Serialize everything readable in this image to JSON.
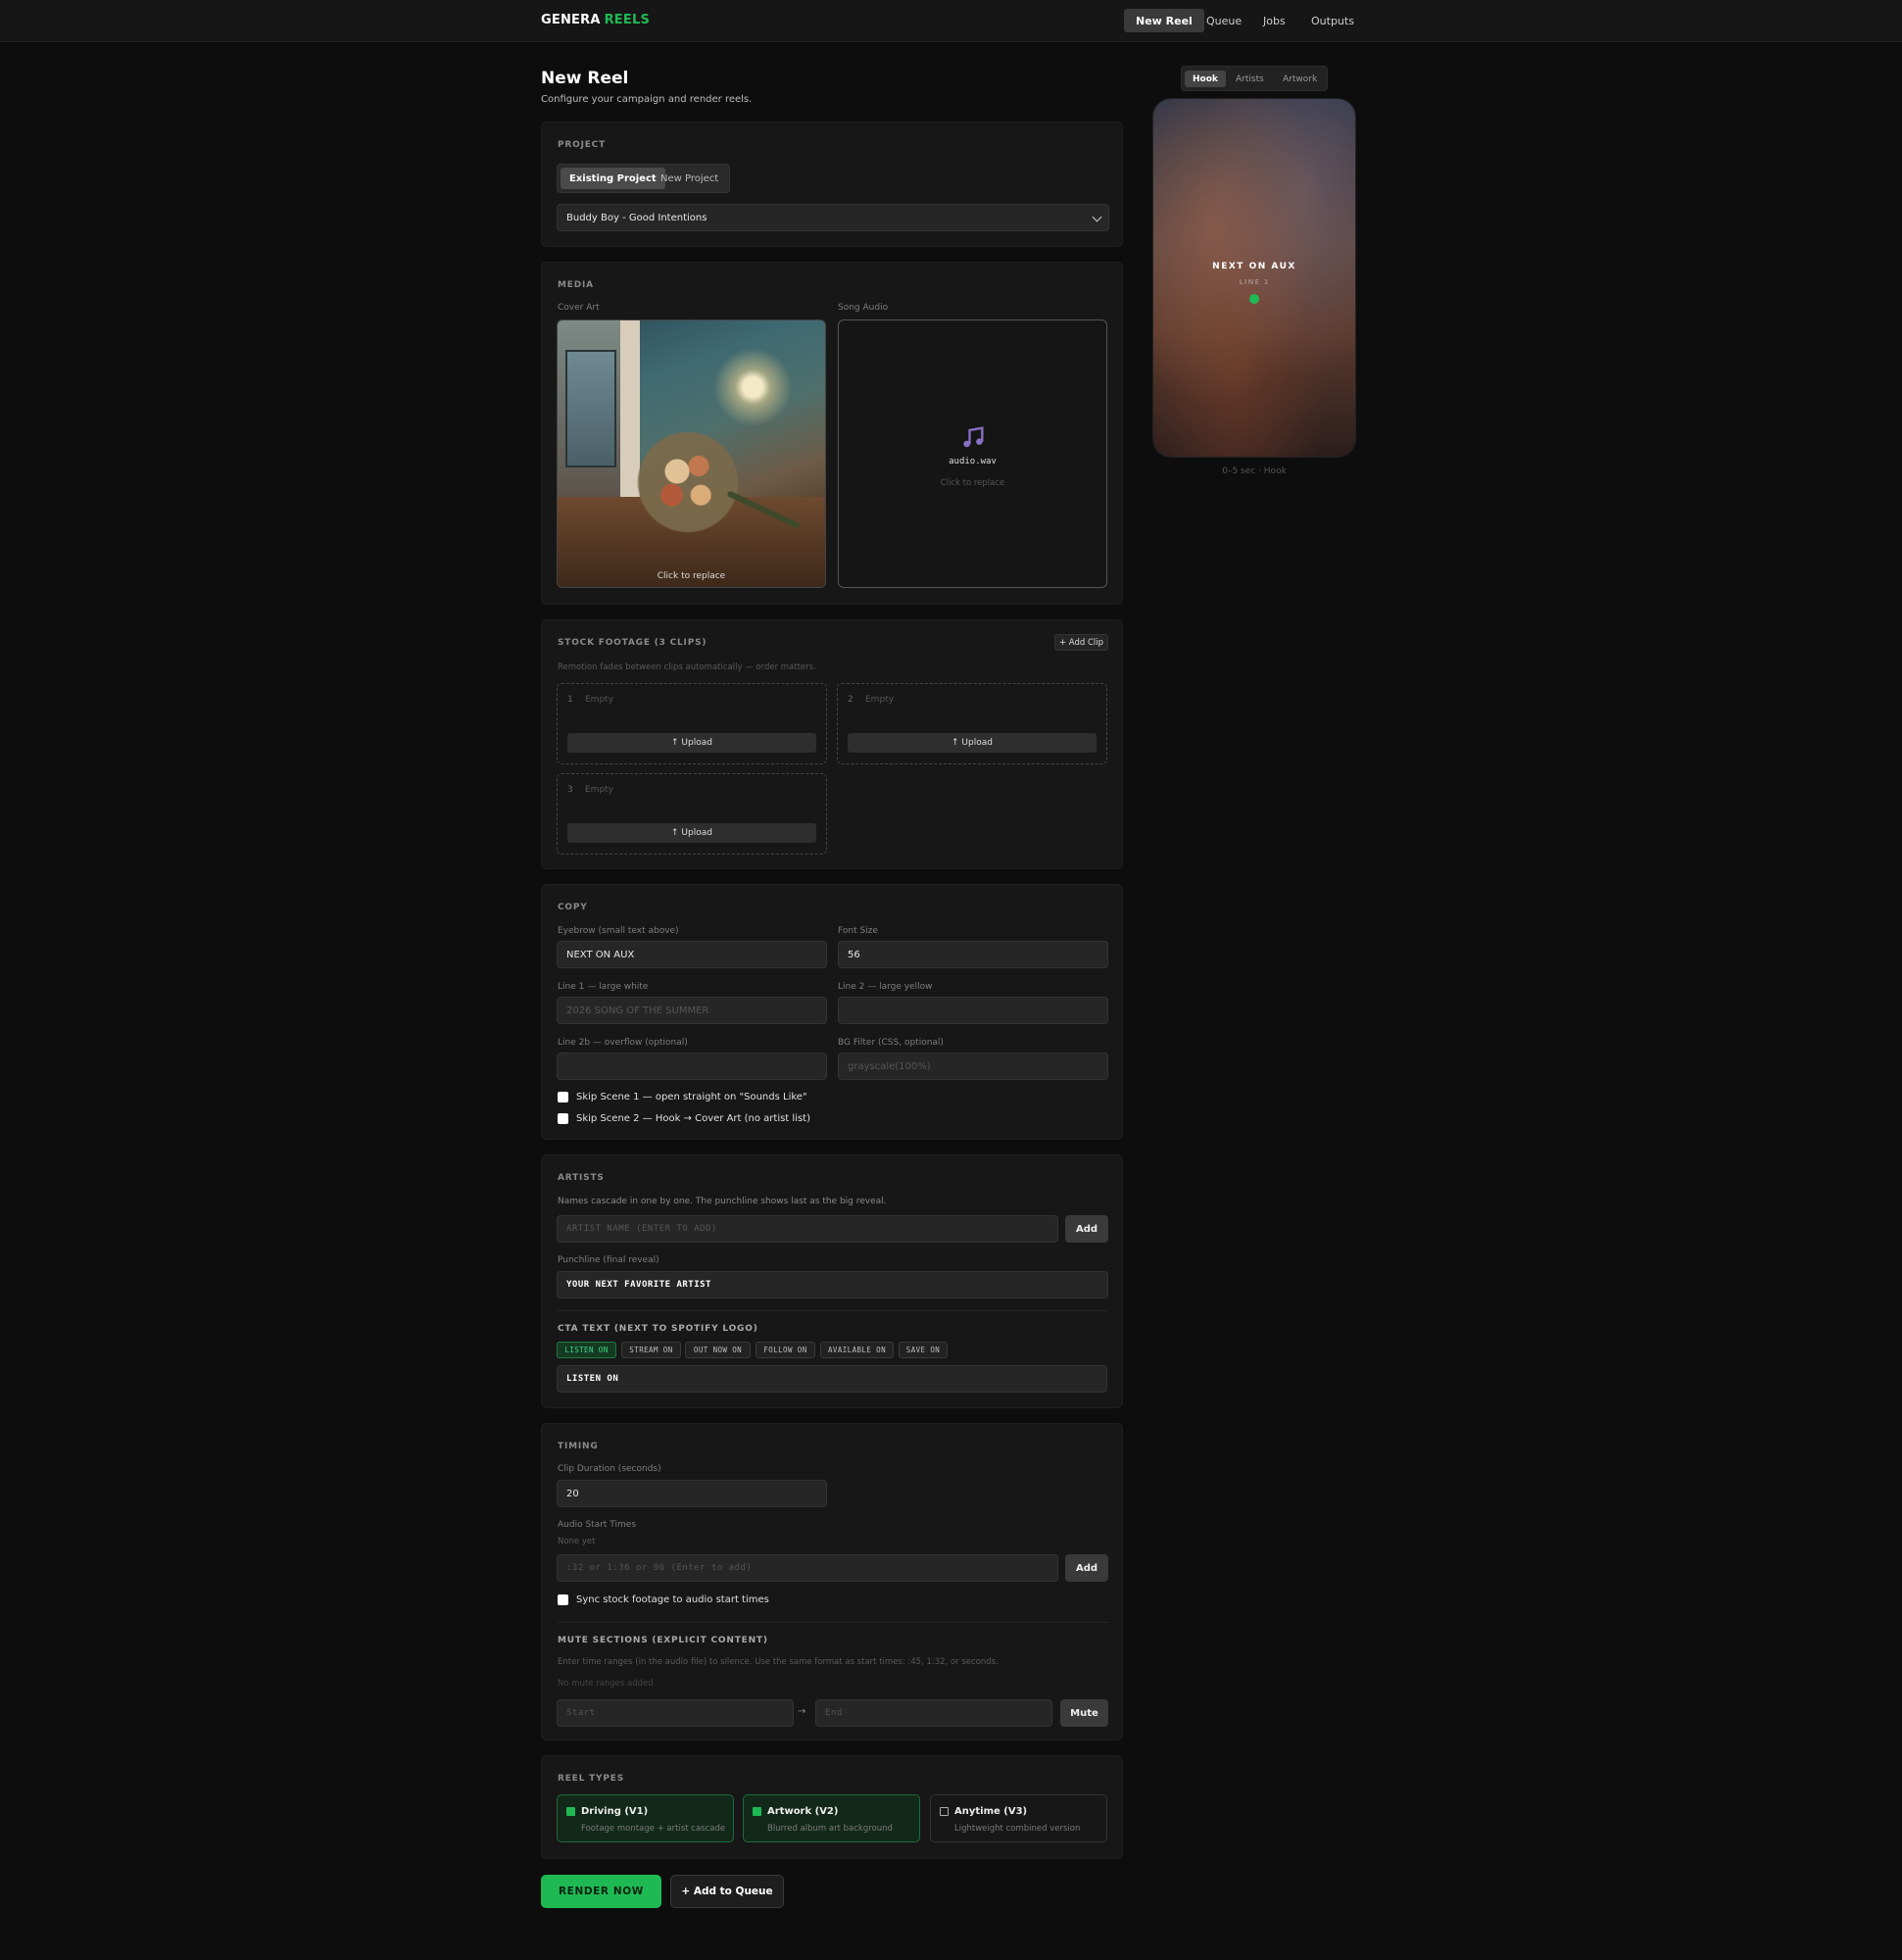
{
  "app": {
    "brand_part1": "GENERA",
    "brand_part2": "REELS",
    "accent": "#1fb954"
  },
  "nav": [
    "New Reel",
    "Queue",
    "Jobs",
    "Outputs"
  ],
  "page": {
    "title": "New Reel",
    "subtitle": "Configure your campaign and render reels."
  },
  "project": {
    "label": "PROJECT",
    "tabs": [
      "Existing Project",
      "New Project"
    ],
    "selected": "Buddy Boy - Good Intentions"
  },
  "media": {
    "label": "MEDIA",
    "cover_label": "Cover Art",
    "cover_caption": "Click to replace",
    "audio_label": "Song Audio",
    "audio_file": "audio.wav",
    "audio_caption": "Click to replace"
  },
  "stock": {
    "label": "STOCK FOOTAGE (3 CLIPS)",
    "add_clip": "+ Add Clip",
    "hint": "Remotion fades between clips automatically — order matters.",
    "clips": [
      {
        "num": "1",
        "status": "Empty",
        "upload": "↑ Upload"
      },
      {
        "num": "2",
        "status": "Empty",
        "upload": "↑ Upload"
      },
      {
        "num": "3",
        "status": "Empty",
        "upload": "↑ Upload"
      }
    ]
  },
  "copy": {
    "label": "COPY",
    "eyebrow_label": "Eyebrow (small text above)",
    "eyebrow_value": "NEXT ON AUX",
    "font_size_label": "Font Size",
    "font_size_value": "56",
    "line1_label": "Line 1 — large white",
    "line1_placeholder": "2026 SONG OF THE SUMMER",
    "line2_label": "Line 2 — large yellow",
    "line2b_label": "Line 2b — overflow (optional)",
    "bgfilter_label": "BG Filter (CSS, optional)",
    "bgfilter_placeholder": "grayscale(100%)",
    "skip1": "Skip Scene 1 — open straight on \"Sounds Like\"",
    "skip2": "Skip Scene 2 — Hook → Cover Art (no artist list)"
  },
  "artists": {
    "label": "ARTISTS",
    "hint": "Names cascade in one by one. The punchline shows last as the big reveal.",
    "input_placeholder": "ARTIST NAME  (ENTER TO ADD)",
    "add": "Add",
    "punchline_label": "Punchline (final reveal)",
    "punchline_value": "YOUR NEXT FAVORITE ARTIST",
    "cta_label": "CTA TEXT (NEXT TO SPOTIFY LOGO)",
    "cta_options": [
      "LISTEN ON",
      "STREAM ON",
      "OUT NOW ON",
      "FOLLOW ON",
      "AVAILABLE ON",
      "SAVE ON"
    ],
    "cta_value": "LISTEN ON"
  },
  "timing": {
    "label": "TIMING",
    "clip_duration_label": "Clip Duration (seconds)",
    "clip_duration_value": "20",
    "audio_start_label": "Audio Start Times",
    "audio_start_empty": "None yet",
    "audio_start_placeholder": ":32 or 1:36 or 96  (Enter to add)",
    "add": "Add",
    "sync_label": "Sync stock footage to audio start times",
    "mute_label": "MUTE SECTIONS (EXPLICIT CONTENT)",
    "mute_hint": "Enter time ranges (in the audio file) to silence. Use the same format as start times: :45, 1:32, or seconds.",
    "mute_empty": "No mute ranges added",
    "start_placeholder": "Start",
    "arrow": "→",
    "end_placeholder": "End",
    "mute_button": "Mute"
  },
  "reel_types": {
    "label": "REEL TYPES",
    "items": [
      {
        "title": "Driving (V1)",
        "desc": "Footage montage + artist cascade"
      },
      {
        "title": "Artwork (V2)",
        "desc": "Blurred album art background"
      },
      {
        "title": "Anytime (V3)",
        "desc": "Lightweight combined version"
      }
    ]
  },
  "actions": {
    "render": "RENDER NOW",
    "queue": "+ Add to Queue"
  },
  "preview": {
    "tabs": [
      "Hook",
      "Artists",
      "Artwork"
    ],
    "eyebrow": "NEXT ON AUX",
    "line1": "LINE 1",
    "caption": "0–5 sec · Hook"
  }
}
